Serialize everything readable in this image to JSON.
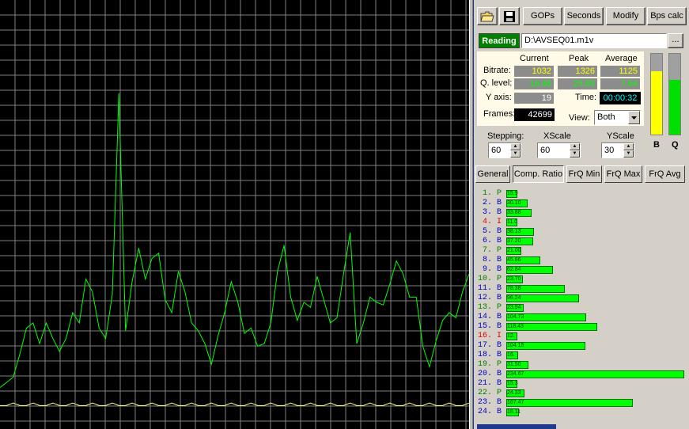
{
  "toolbar": {
    "open_icon": "folder-open-icon",
    "save_icon": "floppy-disk-icon",
    "gops_label": "GOPs",
    "seconds_label": "Seconds",
    "modify_label": "Modify",
    "bps_calc_label": "Bps calc"
  },
  "file": {
    "status_label": "Reading",
    "path": "D:\\AVSEQ01.m1v",
    "browse_label": "..."
  },
  "stats": {
    "col_current": "Current",
    "col_peak": "Peak",
    "col_average": "Average",
    "bitrate_label": "Bitrate:",
    "bitrate_current": "1032",
    "bitrate_peak": "1326",
    "bitrate_average": "1125",
    "qlevel_label": "Q. level:",
    "qlevel_current": "16.88",
    "qlevel_peak": "25.89",
    "qlevel_average": "7.64",
    "yaxis_label": "Y axis:",
    "yaxis_value": "19",
    "time_label": "Time:",
    "time_value": "00:00:32",
    "frames_label": "Frames:",
    "frames_value": "42699",
    "view_label": "View:",
    "view_value": "Both"
  },
  "meters": {
    "b_label": "B",
    "q_label": "Q",
    "b_level": 0.78,
    "q_level": 0.68,
    "b_color": "#ffff00",
    "q_color": "#00e000"
  },
  "controls": {
    "stepping_label": "Stepping:",
    "stepping_value": "60",
    "xscale_label": "XScale",
    "xscale_value": "60",
    "yscale_label": "YScale",
    "yscale_value": "30"
  },
  "tabs": [
    {
      "label": "General"
    },
    {
      "label": "Comp. Ratio"
    },
    {
      "label": "FrQ Min"
    },
    {
      "label": "FrQ Max"
    },
    {
      "label": "FrQ Avg"
    }
  ],
  "active_tab": "Comp. Ratio",
  "frames": [
    {
      "label": "1. P",
      "value": "15.9",
      "ratio": 0.06,
      "color": "#008000"
    },
    {
      "label": "2. B",
      "value": "30.10",
      "ratio": 0.12,
      "color": "#0000c0"
    },
    {
      "label": "3. B",
      "value": "33.88",
      "ratio": 0.14,
      "color": "#0000c0"
    },
    {
      "label": "4. I",
      "value": "11.0",
      "ratio": 0.05,
      "color": "#e00000"
    },
    {
      "label": "5. B",
      "value": "38.13",
      "ratio": 0.155,
      "color": "#0000c0"
    },
    {
      "label": "6. B",
      "value": "37.20",
      "ratio": 0.15,
      "color": "#0000c0"
    },
    {
      "label": "7. P",
      "value": "21.00",
      "ratio": 0.085,
      "color": "#008000"
    },
    {
      "label": "8. B",
      "value": "45.86",
      "ratio": 0.19,
      "color": "#0000c0"
    },
    {
      "label": "9. B",
      "value": "62.84",
      "ratio": 0.26,
      "color": "#0000c0"
    },
    {
      "label": "10. P",
      "value": "23.70",
      "ratio": 0.095,
      "color": "#008000"
    },
    {
      "label": "11. B",
      "value": "78.38",
      "ratio": 0.33,
      "color": "#0000c0"
    },
    {
      "label": "12. B",
      "value": "96.24",
      "ratio": 0.41,
      "color": "#0000c0"
    },
    {
      "label": "13. P",
      "value": "23.94",
      "ratio": 0.096,
      "color": "#008000"
    },
    {
      "label": "14. B",
      "value": "104.73",
      "ratio": 0.45,
      "color": "#0000c0"
    },
    {
      "label": "15. B",
      "value": "118.43",
      "ratio": 0.51,
      "color": "#0000c0"
    },
    {
      "label": "16. I",
      "value": "12.",
      "ratio": 0.05,
      "color": "#e00000"
    },
    {
      "label": "17. B",
      "value": "104.15",
      "ratio": 0.445,
      "color": "#0000c0"
    },
    {
      "label": "18. B",
      "value": "16.",
      "ratio": 0.065,
      "color": "#0000c0"
    },
    {
      "label": "19. P",
      "value": "31.50",
      "ratio": 0.125,
      "color": "#008000"
    },
    {
      "label": "20. B",
      "value": "234.67",
      "ratio": 1.0,
      "color": "#0000c0"
    },
    {
      "label": "21. B",
      "value": "15.3",
      "ratio": 0.06,
      "color": "#0000c0"
    },
    {
      "label": "22. P",
      "value": "24.33",
      "ratio": 0.1,
      "color": "#008000"
    },
    {
      "label": "23. B",
      "value": "167.47",
      "ratio": 0.71,
      "color": "#0000c0"
    },
    {
      "label": "24. B",
      "value": "18.11",
      "ratio": 0.07,
      "color": "#0000c0"
    }
  ],
  "graph": {
    "grid_color": "#808080",
    "bitrate_color": "#00ff00",
    "qlevel_color": "#ffff80",
    "bitrate_series": [
      1.3,
      1.5,
      1.7,
      2.6,
      3.6,
      3.8,
      3.0,
      3.8,
      3.2,
      2.7,
      3.2,
      4.2,
      3.8,
      5.5,
      5.0,
      3.6,
      3.2,
      4.9,
      12.7,
      3.5,
      5.4,
      6.7,
      5.5,
      6.3,
      6.5,
      4.7,
      4.2,
      5.8,
      5.0,
      3.8,
      3.5,
      3.0,
      2.2,
      3.3,
      4.2,
      5.4,
      4.6,
      3.4,
      3.6,
      2.9,
      3.0,
      3.8,
      5.8,
      6.8,
      4.8,
      3.9,
      4.6,
      4.4,
      5.6,
      4.7,
      3.8,
      4.0,
      5.7,
      7.3,
      3.0,
      3.8,
      4.8,
      4.6,
      4.5,
      5.3,
      6.2,
      5.7,
      4.8,
      4.8,
      2.9,
      2.1,
      3.1,
      3.9,
      4.2,
      4.0,
      5.0,
      5.7
    ],
    "qlevel_series": [
      0.6,
      0.6,
      0.7,
      0.6,
      0.6,
      0.7,
      0.6,
      0.6,
      0.7,
      0.6,
      0.6,
      0.7,
      0.6,
      0.6,
      0.7,
      0.6,
      0.6,
      0.7,
      0.6,
      0.6,
      0.7,
      0.6,
      0.6,
      0.7,
      0.6,
      0.6,
      0.7,
      0.6,
      0.6,
      0.7,
      0.6,
      0.6,
      0.7,
      0.6,
      0.6,
      0.7,
      0.6,
      0.6,
      0.7,
      0.6,
      0.6,
      0.7,
      0.6,
      0.6,
      0.7,
      0.6,
      0.6,
      0.7,
      0.6,
      0.6,
      0.7,
      0.6,
      0.6,
      0.7,
      0.6,
      0.6,
      0.7,
      0.6,
      0.6,
      0.7,
      0.6,
      0.6,
      0.7,
      0.6,
      0.6,
      0.7,
      0.6,
      0.6,
      0.7,
      0.6,
      0.6,
      0.7
    ],
    "y_max": 16
  }
}
